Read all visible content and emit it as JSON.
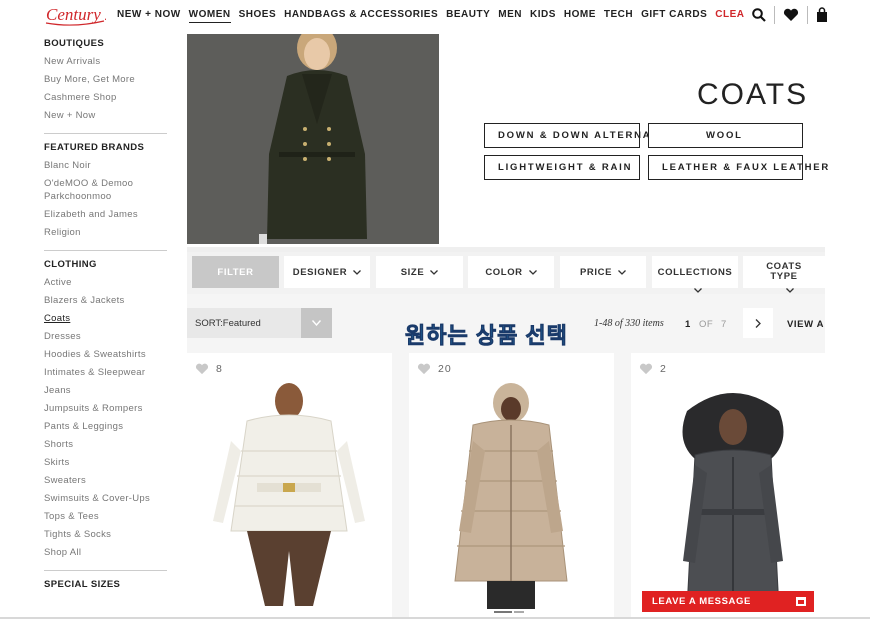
{
  "brand": {
    "logo_text": "Century 21"
  },
  "nav": {
    "links": [
      "NEW + NOW",
      "WOMEN",
      "SHOES",
      "HANDBAGS & ACCESSORIES",
      "BEAUTY",
      "MEN",
      "KIDS",
      "HOME",
      "TECH",
      "GIFT CARDS",
      "CLEA"
    ],
    "active": "WOMEN",
    "icons": [
      "search-icon",
      "heart-icon",
      "bag-icon"
    ]
  },
  "sidebar": {
    "sections": [
      {
        "heading": "BOUTIQUES",
        "items": [
          "New Arrivals",
          "Buy More, Get More",
          "Cashmere Shop",
          "New + Now"
        ]
      },
      {
        "heading": "FEATURED BRANDS",
        "items": [
          "Blanc Noir",
          "O'deMOO & Demoo Parkchoonmoo",
          "Elizabeth and James",
          "Religion"
        ]
      },
      {
        "heading": "CLOTHING",
        "items": [
          "Active",
          "Blazers & Jackets",
          "Coats",
          "Dresses",
          "Hoodies & Sweatshirts",
          "Intimates & Sleepwear",
          "Jeans",
          "Jumpsuits & Rompers",
          "Pants & Leggings",
          "Shorts",
          "Skirts",
          "Sweaters",
          "Swimsuits & Cover-Ups",
          "Tops & Tees",
          "Tights & Socks",
          "Shop All"
        ]
      },
      {
        "heading": "SPECIAL SIZES",
        "items": []
      }
    ],
    "current": "Coats"
  },
  "hero": {
    "title": "COATS",
    "categories": [
      "DOWN & DOWN ALTERNATIVE",
      "WOOL",
      "LIGHTWEIGHT & RAIN",
      "LEATHER & FAUX LEATHER"
    ]
  },
  "filters": {
    "filter_label": "FILTER",
    "buttons": [
      "DESIGNER",
      "SIZE",
      "COLOR",
      "PRICE",
      "COLLECTIONS",
      "COATS TYPE"
    ],
    "coats_type_lines": [
      "COATS",
      "TYPE"
    ]
  },
  "sort": {
    "label": "SORT:Featured",
    "overlay_text": "원하는 상품 선택",
    "counts": "1-48 of 330 items",
    "page_current": "1",
    "page_of": "OF",
    "page_total": "7",
    "view_all": "VIEW A"
  },
  "products": [
    {
      "likes": "8",
      "image": "white puffer jacket"
    },
    {
      "likes": "20",
      "image": "beige down coat"
    },
    {
      "likes": "2",
      "image": "grey coat with fur hood"
    }
  ],
  "chat": {
    "label": "LEAVE A MESSAGE"
  },
  "colors": {
    "sale": "#d0272b",
    "chat": "#e02222",
    "overlay": "#2aa0d8"
  }
}
